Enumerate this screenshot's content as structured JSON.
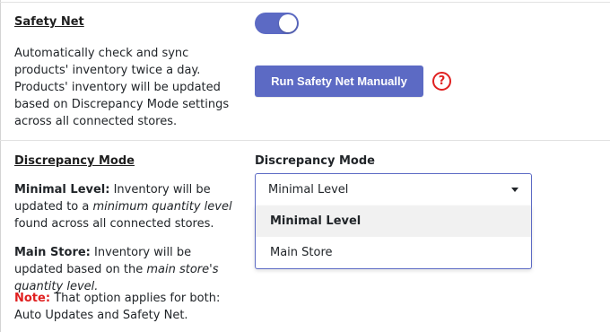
{
  "safety_net": {
    "title": "Safety Net",
    "description": "Automatically check and sync products' inventory twice a day. Products' inventory will be updated based on Discrepancy Mode settings across all connected stores.",
    "toggle_on": true,
    "run_button_label": "Run Safety Net Manually",
    "help_icon": "question-circle-icon",
    "help_glyph": "?"
  },
  "discrepancy_mode": {
    "title": "Discrepancy Mode",
    "minimal_label": "Minimal Level:",
    "minimal_text_1": "Inventory will be updated to a",
    "minimal_emph": "minimum quantity level",
    "minimal_text_2": "found across all connected stores.",
    "main_label": "Main Store:",
    "main_text_1": "Inventory will be updated based on the",
    "main_emph": "main store's quantity level.",
    "note_label": "Note:",
    "note_text": "That option applies for both: Auto Updates and Safety Net.",
    "field_label": "Discrepancy Mode",
    "selected_value": "Minimal Level",
    "options": [
      "Minimal Level",
      "Main Store"
    ]
  },
  "colors": {
    "accent": "#5c6ac4",
    "note_red": "#e02020"
  }
}
